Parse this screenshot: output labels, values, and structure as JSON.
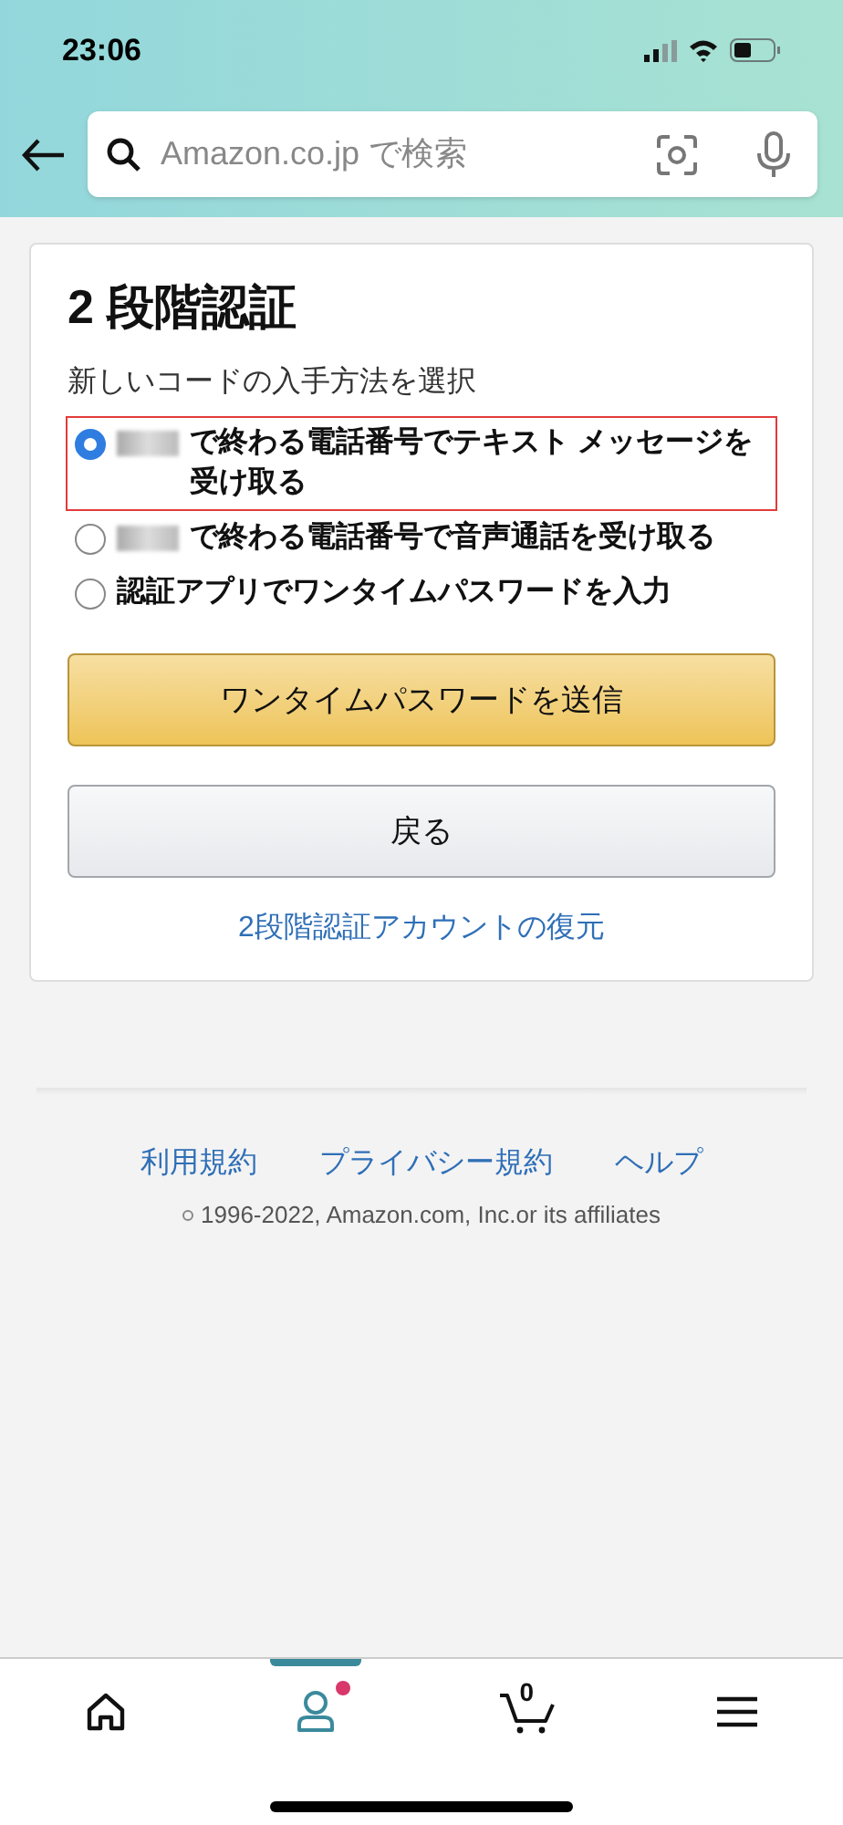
{
  "status_bar": {
    "time": "23:06"
  },
  "search": {
    "placeholder": "Amazon.co.jp で検索"
  },
  "card": {
    "title": "2 段階認証",
    "subtitle": "新しいコードの入手方法を選択",
    "options": [
      {
        "label": "で終わる電話番号でテキスト メッセージを受け取る",
        "redacted": true,
        "selected": true
      },
      {
        "label": "で終わる電話番号で音声通話を受け取る",
        "redacted": true,
        "selected": false
      },
      {
        "label": "認証アプリでワンタイムパスワードを入力",
        "redacted": false,
        "selected": false
      }
    ],
    "primary_button": "ワンタイムパスワードを送信",
    "secondary_button": "戻る",
    "link": "2段階認証アカウントの復元"
  },
  "footer": {
    "links": [
      "利用規約",
      "プライバシー規約",
      "ヘルプ"
    ],
    "copyright": "1996-2022, Amazon.com, Inc.or its affiliates"
  },
  "tab_bar": [
    {
      "kind": "home",
      "selected": false
    },
    {
      "kind": "account",
      "selected": true,
      "badge": true
    },
    {
      "kind": "cart",
      "selected": false,
      "count": "0"
    },
    {
      "kind": "menu",
      "selected": false
    }
  ]
}
